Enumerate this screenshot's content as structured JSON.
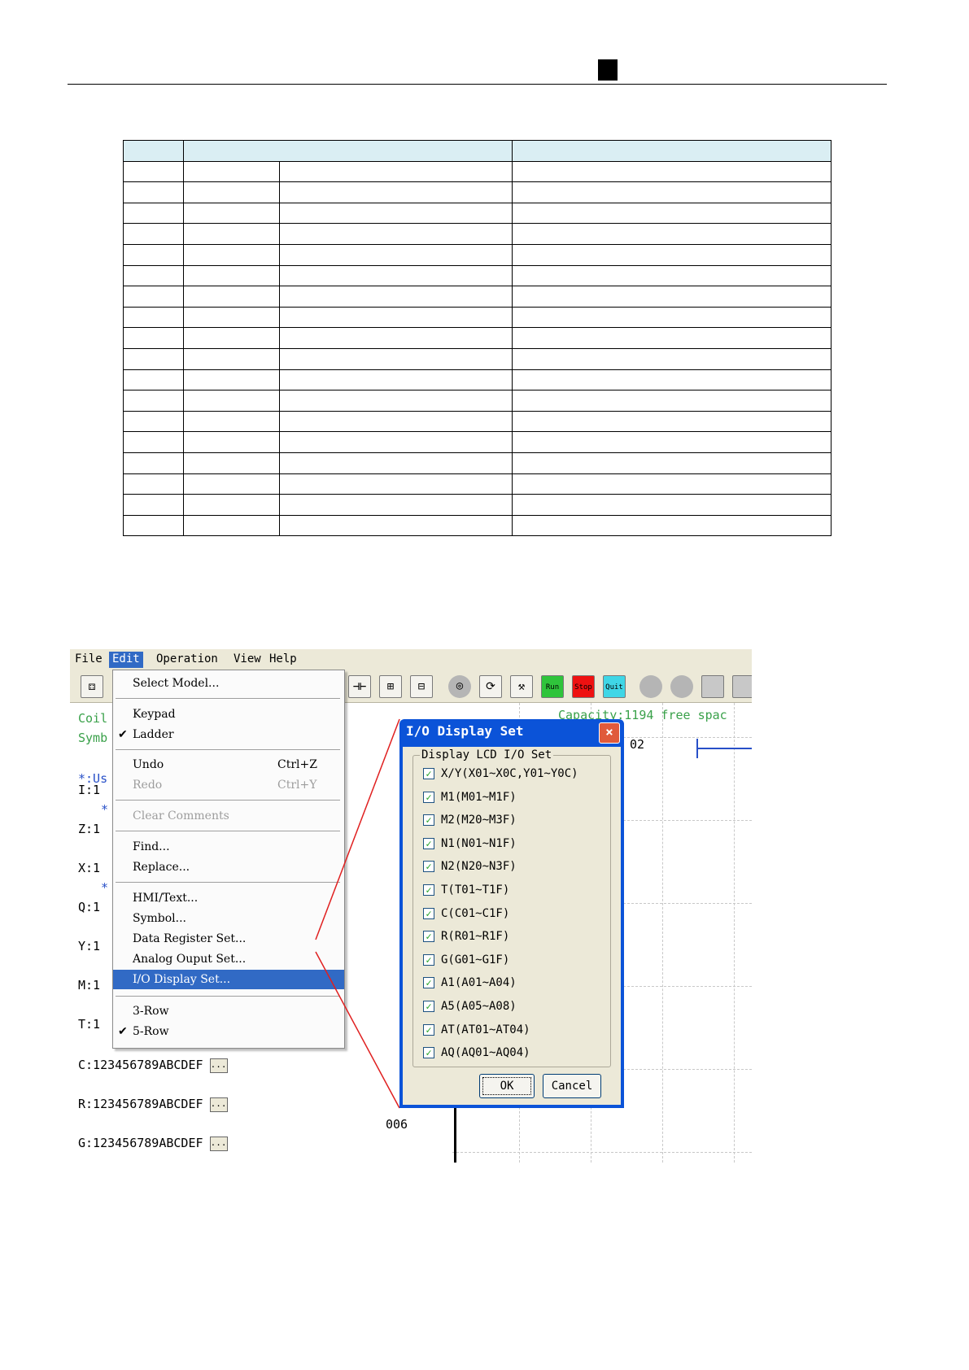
{
  "window": {
    "menubar": [
      "File",
      "Edit",
      "Operation",
      "View",
      "Help"
    ],
    "active_menu": "Edit"
  },
  "edit_menu": {
    "items": [
      {
        "label": "Select Model...",
        "shortcut": "",
        "checked": false,
        "disabled": false
      },
      {
        "label": "Keypad",
        "shortcut": "",
        "checked": false,
        "disabled": false
      },
      {
        "label": "Ladder",
        "shortcut": "",
        "checked": true,
        "disabled": false
      },
      {
        "label": "Undo",
        "shortcut": "Ctrl+Z",
        "checked": false,
        "disabled": false
      },
      {
        "label": "Redo",
        "shortcut": "Ctrl+Y",
        "checked": false,
        "disabled": true
      },
      {
        "label": "Clear Comments",
        "shortcut": "",
        "checked": false,
        "disabled": true
      },
      {
        "label": "Find...",
        "shortcut": "",
        "checked": false,
        "disabled": false
      },
      {
        "label": "Replace...",
        "shortcut": "",
        "checked": false,
        "disabled": false
      },
      {
        "label": "HMI/Text...",
        "shortcut": "",
        "checked": false,
        "disabled": false
      },
      {
        "label": "Symbol...",
        "shortcut": "",
        "checked": false,
        "disabled": false
      },
      {
        "label": "Data Register Set...",
        "shortcut": "",
        "checked": false,
        "disabled": false
      },
      {
        "label": "Analog Ouput Set...",
        "shortcut": "",
        "checked": false,
        "disabled": false
      },
      {
        "label": "I/O Display Set...",
        "shortcut": "",
        "checked": false,
        "disabled": false,
        "highlighted": true
      },
      {
        "label": "3-Row",
        "shortcut": "",
        "checked": false,
        "disabled": false
      },
      {
        "label": "5-Row",
        "shortcut": "",
        "checked": true,
        "disabled": false
      }
    ]
  },
  "toolbar": {
    "run_label": "Run",
    "stop_label": "Stop",
    "quit_label": "Quit"
  },
  "editor": {
    "capacity": "Capacity:1194 free spac",
    "coil_label": "Coil",
    "symb_label": "Symb",
    "user_label": "*:Us",
    "rows": [
      {
        "text": "I:1"
      },
      {
        "text": "Z:1"
      },
      {
        "text": "X:1"
      },
      {
        "text": "Q:1"
      },
      {
        "text": "Y:1"
      },
      {
        "text": "M:1"
      },
      {
        "text": "T:1"
      }
    ],
    "full_rows": [
      "C:123456789ABCDEF",
      "R:123456789ABCDEF",
      "G:123456789ABCDEF"
    ],
    "dots": "...",
    "star": "*",
    "addr_top": "02",
    "addr_bottom": "006"
  },
  "dialog": {
    "title": "I/O Display Set",
    "close": "×",
    "group_label": "Display LCD I/O Set",
    "check_mark": "✓",
    "options": [
      "X/Y(X01~X0C,Y01~Y0C)",
      "M1(M01~M1F)",
      "M2(M20~M3F)",
      "N1(N01~N1F)",
      "N2(N20~N3F)",
      "T(T01~T1F)",
      "C(C01~C1F)",
      "R(R01~R1F)",
      "G(G01~G1F)",
      "A1(A01~A04)",
      "A5(A05~A08)",
      "AT(AT01~AT04)",
      "AQ(AQ01~AQ04)"
    ],
    "ok": "OK",
    "cancel": "Cancel"
  },
  "colors": {
    "table_header": "#daeef3",
    "menu_highlight": "#316ac5",
    "dialog_frame": "#0b53d8",
    "callout_line": "#e02020"
  }
}
